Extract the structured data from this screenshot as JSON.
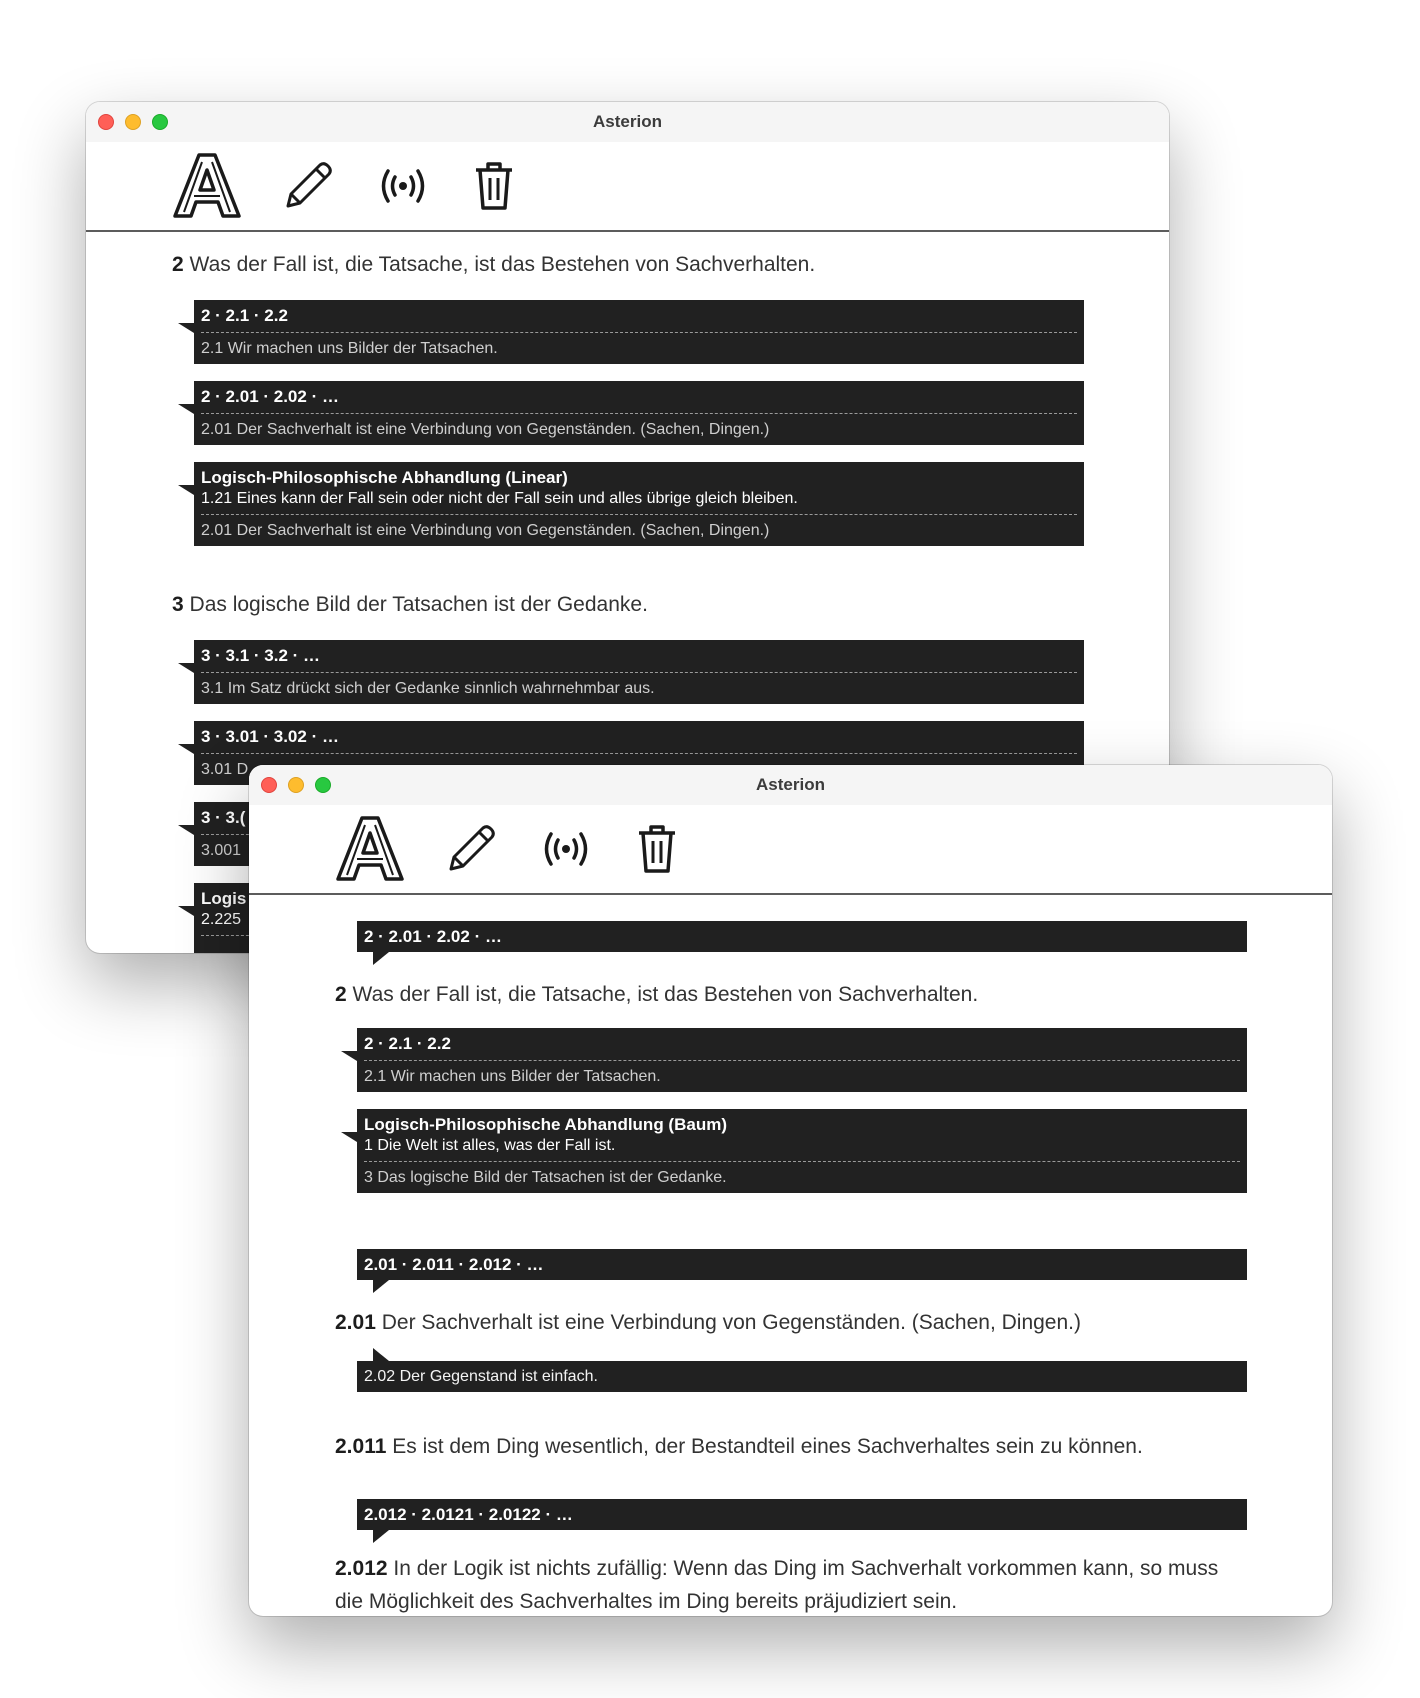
{
  "windows": [
    {
      "title": "Asterion",
      "toolbar": {
        "icons": [
          "asterion-logo-icon",
          "pencil-icon",
          "broadcast-icon",
          "trash-icon"
        ]
      },
      "content": [
        {
          "kind": "para",
          "num": "2",
          "text": "Was der Fall ist, die Tatsache, ist das Bestehen von Sachverhalten."
        },
        {
          "kind": "box",
          "head": "2 · 2.1 · 2.2",
          "sub": "2.1 Wir machen uns Bilder der Tatsachen."
        },
        {
          "kind": "box",
          "head": "2 · 2.01 · 2.02 · …",
          "sub": "2.01 Der Sachverhalt ist eine Verbindung von Gegenständen. (Sachen, Dingen.)"
        },
        {
          "kind": "box",
          "head": "Logisch-Philosophische Abhandlung (Linear)",
          "line": "1.21 Eines kann der Fall sein oder nicht der Fall sein und alles übrige gleich bleiben.",
          "sub": "2.01 Der Sachverhalt ist eine Verbindung von Gegenständen. (Sachen, Dingen.)"
        },
        {
          "kind": "para",
          "num": "3",
          "text": "Das logische Bild der Tatsachen ist der Gedanke."
        },
        {
          "kind": "box",
          "head": "3 · 3.1 · 3.2 · …",
          "sub": "3.1 Im Satz drückt sich der Gedanke sinnlich wahrnehmbar aus."
        },
        {
          "kind": "box",
          "head": "3 · 3.01 · 3.02 · …",
          "sub": "3.01 D"
        },
        {
          "kind": "box",
          "head": "3 · 3.(",
          "sub": "3.001"
        },
        {
          "kind": "box",
          "head": "Logis",
          "line": "2.225"
        }
      ]
    },
    {
      "title": "Asterion",
      "toolbar": {
        "icons": [
          "asterion-logo-icon",
          "pencil-icon",
          "broadcast-icon",
          "trash-icon"
        ]
      },
      "content": [
        {
          "kind": "box",
          "pointer": "bottom",
          "head": "2 · 2.01 · 2.02 · …"
        },
        {
          "kind": "para",
          "num": "2",
          "text": "Was der Fall ist, die Tatsache, ist das Bestehen von Sachverhalten."
        },
        {
          "kind": "box",
          "head": "2 · 2.1 · 2.2",
          "sub": "2.1 Wir machen uns Bilder der Tatsachen."
        },
        {
          "kind": "box",
          "head": "Logisch-Philosophische Abhandlung (Baum)",
          "line": "1 Die Welt ist alles, was der Fall ist.",
          "sub": "3 Das logische Bild der Tatsachen ist der Gedanke."
        },
        {
          "kind": "box",
          "pointer": "bottom",
          "head": "2.01 · 2.011 · 2.012 · …"
        },
        {
          "kind": "para",
          "num": "2.01",
          "text": "Der Sachverhalt ist eine Verbindung von Gegenständen. (Sachen, Dingen.)"
        },
        {
          "kind": "box",
          "pointer": "top",
          "plain": "2.02 Der Gegenstand ist einfach."
        },
        {
          "kind": "para",
          "num": "2.011",
          "text": "Es ist dem Ding wesentlich, der Bestandteil eines Sachverhaltes sein zu können."
        },
        {
          "kind": "box",
          "pointer": "bottom",
          "head": "2.012 · 2.0121 · 2.0122 · …"
        },
        {
          "kind": "para",
          "num": "2.012",
          "text": "In der Logik ist nichts zufällig: Wenn das Ding im Sachverhalt vorkommen kann, so muss die Möglichkeit des Sachverhaltes im Ding bereits präjudiziert sein."
        }
      ]
    }
  ]
}
